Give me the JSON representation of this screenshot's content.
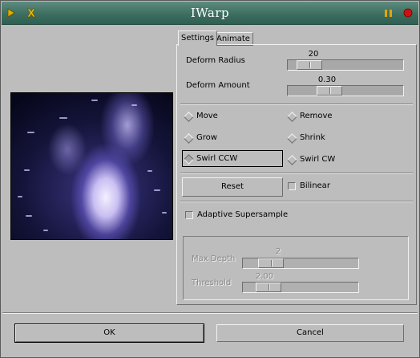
{
  "window": {
    "title": "IWarp"
  },
  "tabs": [
    {
      "label": "Settings"
    },
    {
      "label": "Animate"
    }
  ],
  "settings": {
    "deform_radius": {
      "label": "Deform Radius",
      "value": "20",
      "fraction": 0.1
    },
    "deform_amount": {
      "label": "Deform Amount",
      "value": "0.30",
      "fraction": 0.32
    },
    "modes": [
      {
        "label": "Move",
        "selected": false
      },
      {
        "label": "Remove",
        "selected": false
      },
      {
        "label": "Grow",
        "selected": false
      },
      {
        "label": "Shrink",
        "selected": false
      },
      {
        "label": "Swirl CCW",
        "selected": true
      },
      {
        "label": "Swirl CW",
        "selected": false
      }
    ],
    "reset_label": "Reset",
    "bilinear_label": "Bilinear",
    "adaptive_label": "Adaptive Supersample",
    "max_depth": {
      "label": "Max Depth",
      "value": "2",
      "fraction": 0.17
    },
    "threshold": {
      "label": "Threshold",
      "value": "2.00",
      "fraction": 0.14
    }
  },
  "buttons": {
    "ok": "OK",
    "cancel": "Cancel"
  },
  "colors": {
    "titlebar": "#3d6e60",
    "close_button": "#d01010",
    "pause_button": "#e0a800"
  }
}
